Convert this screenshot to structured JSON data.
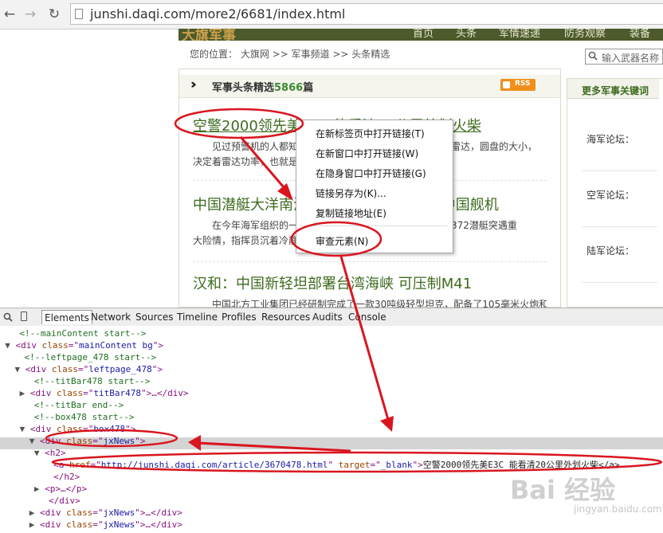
{
  "browser": {
    "url": "junshi.daqi.com/more2/6681/index.html",
    "back_icon": "back-arrow-icon",
    "forward_icon": "forward-arrow-icon",
    "reload_icon": "reload-icon"
  },
  "site": {
    "logo": "大旗军事",
    "header_nav": [
      "首页",
      "头条",
      "军情速递",
      "防务观察",
      "装备"
    ],
    "breadcrumb": "您的位置： 大旗网 >> 军事频道 >> 头条精选",
    "search_placeholder": "输入武器名称",
    "section_title": "军事头条精选",
    "section_count": "5866",
    "section_suffix": "篇",
    "rss_label": "RSS",
    "articles": [
      {
        "headline": "空警2000领先美E3C 能看清20公里外划火柴",
        "summary": [
          "见过预警机的人都知道，预警机背上都有个圆盘，那就是雷达，圆盘的大小，",
          "决定着雷达功率，也就是说决定着预警机能看多远。"
        ]
      },
      {
        "headline": "中国潜艇大洋南海大发神威 吓坏美日越中国舰机",
        "summary": [
          "在今年海军组织的一次远航训练中，遭遇突发险情，海军372潜艇突遇重",
          "大险情，指挥员沉着冷静，带领全艇官兵化险为夷。"
        ]
      },
      {
        "headline": "汉和：中国新轻坦部署台湾海峡 可压制M41",
        "summary": [
          "中国北方工业集团已经研制完成了一款30吨级轻型坦克，配备了105毫米火炮和"
        ]
      }
    ],
    "right_title": "更多军事关键词",
    "forums": [
      "海军论坛：",
      "空军论坛：",
      "陆军论坛："
    ]
  },
  "context_menu": {
    "items": [
      "在新标签页中打开链接(T)",
      "在新窗口中打开链接(W)",
      "在隐身窗口中打开链接(G)",
      "链接另存为(K)...",
      "复制链接地址(E)",
      "审查元素(N)"
    ]
  },
  "devtools": {
    "tabs": [
      "Elements",
      "Network",
      "Sources",
      "Timeline",
      "Profiles",
      "Resources",
      "Audits",
      "Console"
    ],
    "dom": [
      {
        "indent": 4,
        "tri": "",
        "kind": "comment",
        "text": "<!--mainContent start-->"
      },
      {
        "indent": 3,
        "tri": "▼",
        "kind": "open",
        "tag": "div",
        "attr": "class",
        "val": "mainContent bg",
        "end": ">"
      },
      {
        "indent": 5,
        "tri": "",
        "kind": "comment",
        "text": "<!--leftpage_478 start-->"
      },
      {
        "indent": 5,
        "tri": "▼",
        "kind": "open",
        "tag": "div",
        "attr": "class",
        "val": "leftpage_478",
        "end": ">"
      },
      {
        "indent": 7,
        "tri": "",
        "kind": "comment",
        "text": "<!--titBar478 start-->"
      },
      {
        "indent": 6,
        "tri": "▶",
        "kind": "open",
        "tag": "div",
        "attr": "class",
        "val": "titBar478",
        "end": ">…</div>"
      },
      {
        "indent": 7,
        "tri": "",
        "kind": "comment",
        "text": "<!--titBar end-->"
      },
      {
        "indent": 7,
        "tri": "",
        "kind": "comment",
        "text": "<!--box478 start-->"
      },
      {
        "indent": 6,
        "tri": "▼",
        "kind": "open",
        "tag": "div",
        "attr": "class",
        "val": "box478",
        "end": ">"
      },
      {
        "indent": 8,
        "tri": "▼",
        "kind": "open",
        "tag": "div",
        "attr": "class",
        "val": "jxNews",
        "end": ">"
      },
      {
        "indent": 9,
        "tri": "▼",
        "kind": "plain",
        "text": "<h2>"
      },
      {
        "indent": 11,
        "tri": "",
        "kind": "link",
        "tag": "a",
        "attr": "href",
        "val": "http://junshi.daqi.com/article/3670478.html",
        "attr2": "target",
        "val2": "_blank",
        "text": "空警2000领先美E3C 能看清20公里外划火柴</a>"
      },
      {
        "indent": 11,
        "tri": "",
        "kind": "plain",
        "text": "</h2>"
      },
      {
        "indent": 9,
        "tri": "▶",
        "kind": "plain",
        "text": "<p>…</p>"
      },
      {
        "indent": 10,
        "tri": "",
        "kind": "plain",
        "text": "</div>"
      },
      {
        "indent": 8,
        "tri": "▶",
        "kind": "open",
        "tag": "div",
        "attr": "class",
        "val": "jxNews",
        "end": ">…</div>"
      },
      {
        "indent": 8,
        "tri": "▶",
        "kind": "open",
        "tag": "div",
        "attr": "class",
        "val": "jxNews",
        "end": ">…</div>"
      },
      {
        "indent": 8,
        "tri": "▶",
        "kind": "open",
        "tag": "div",
        "attr": "class",
        "val": "jxNews",
        "end": ">…</div>"
      }
    ]
  },
  "annotation_color": "#d9161f",
  "watermark": {
    "main": "Bai 经验",
    "sub": "jingyan.baidu.com"
  }
}
